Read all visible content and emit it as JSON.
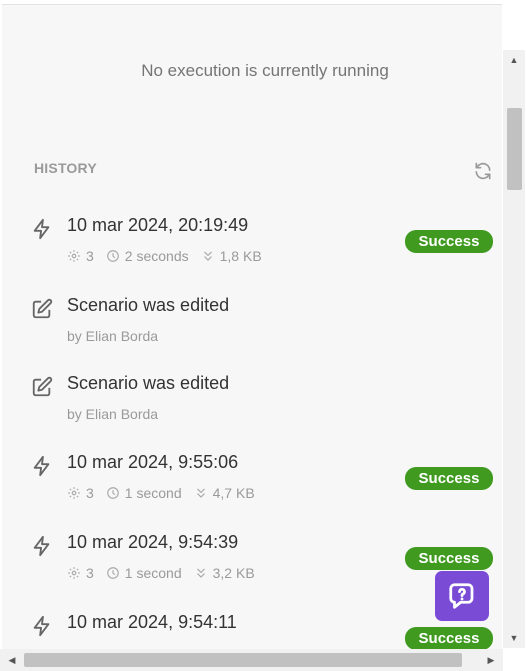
{
  "status_text": "No execution is currently running",
  "history": {
    "title": "HISTORY",
    "entries": [
      {
        "type": "execution",
        "title": "10 mar 2024, 20:19:49",
        "ops": "3",
        "duration": "2 seconds",
        "size": "1,8 KB",
        "status": "Success"
      },
      {
        "type": "edit",
        "title": "Scenario was edited",
        "by": "by Elian Borda"
      },
      {
        "type": "edit",
        "title": "Scenario was edited",
        "by": "by Elian Borda"
      },
      {
        "type": "execution",
        "title": "10 mar 2024, 9:55:06",
        "ops": "3",
        "duration": "1 second",
        "size": "4,7 KB",
        "status": "Success"
      },
      {
        "type": "execution",
        "title": "10 mar 2024, 9:54:39",
        "ops": "3",
        "duration": "1 second",
        "size": "3,2 KB",
        "status": "Success"
      },
      {
        "type": "execution",
        "title": "10 mar 2024, 9:54:11",
        "status": "Success"
      }
    ]
  },
  "colors": {
    "success": "#3f9a1f",
    "help": "#7a4cd6"
  },
  "icons": {
    "execution": "bolt-icon",
    "edit": "edit-icon",
    "ops": "gear-icon",
    "duration": "clock-icon",
    "size": "chevrons-down-icon",
    "refresh": "refresh-icon",
    "help": "help-icon"
  }
}
